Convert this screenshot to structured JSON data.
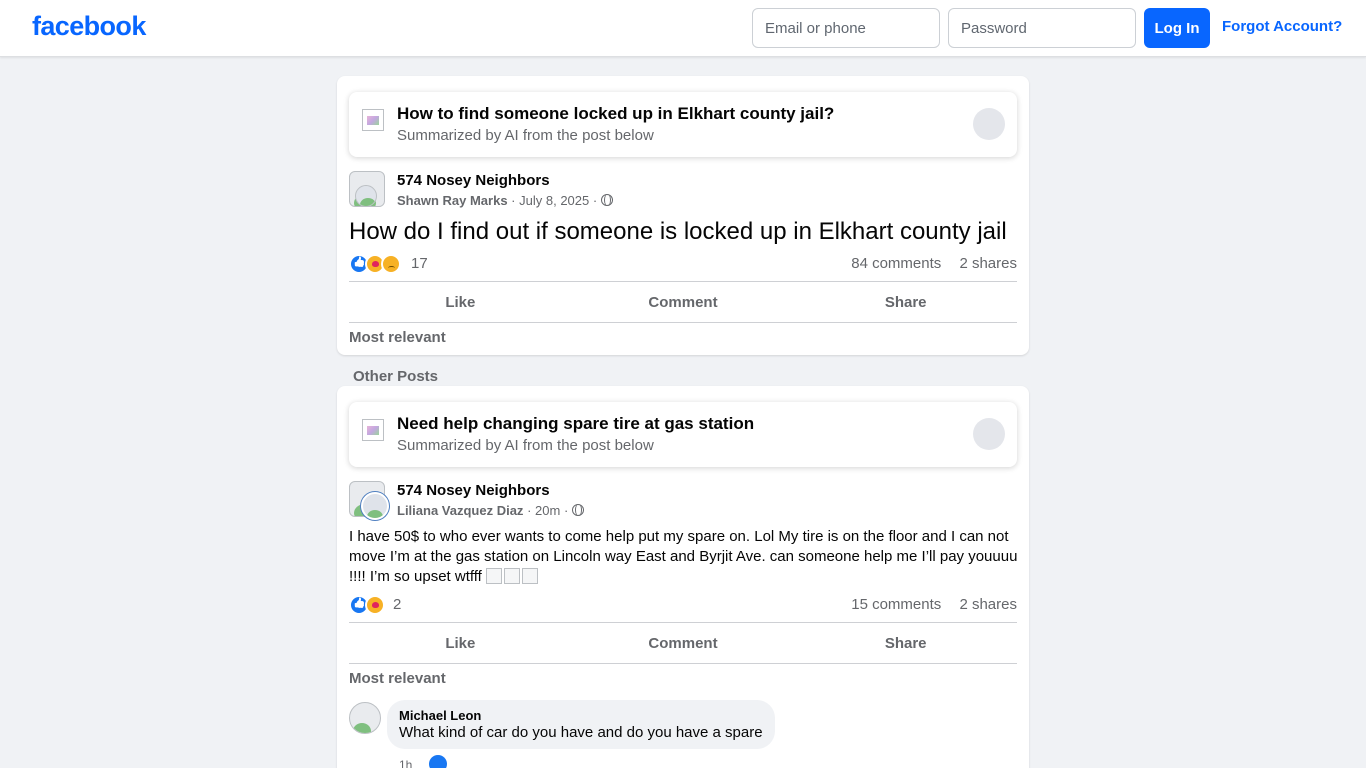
{
  "header": {
    "logo": "facebook",
    "email_placeholder": "Email or phone",
    "password_placeholder": "Password",
    "login_label": "Log In",
    "forgot_label": "Forgot Account?"
  },
  "main_post": {
    "ai_title": "How to find someone locked up in Elkhart county jail?",
    "ai_subtitle": "Summarized by AI from the post below",
    "group": "574 Nosey Neighbors",
    "author": "Shawn Ray Marks",
    "date": "July 8, 2025",
    "sep": "·",
    "text": "How do I find out if someone is locked up in Elkhart county jail",
    "reaction_count": "17",
    "comments": "84 comments",
    "shares": "2 shares",
    "actions": [
      "Like",
      "Comment",
      "Share"
    ],
    "sort": "Most relevant"
  },
  "other_posts_label": "Other Posts",
  "second_post": {
    "ai_title": "Need help changing spare tire at gas station",
    "ai_subtitle": "Summarized by AI from the post below",
    "group": "574 Nosey Neighbors",
    "author": "Liliana Vazquez Diaz",
    "date": "20m",
    "sep": "·",
    "text": "I have 50$ to who ever wants to come help put my spare on. Lol  My tire is on the floor and I can not move I’m at the gas station on Lincoln way East and Byrjit Ave. can someone help me I’ll pay youuuu !!!! I’m so upset wtfff",
    "reaction_count": "2",
    "comments": "15 comments",
    "shares": "2 shares",
    "actions": [
      "Like",
      "Comment",
      "Share"
    ],
    "sort": "Most relevant",
    "comment": {
      "author": "Michael Leon",
      "text": "What kind of car do you have and do you have a spare",
      "time": "1h"
    }
  },
  "colors": {
    "brand": "#0866ff",
    "background": "#f0f2f5",
    "muted_text": "#65676b"
  }
}
